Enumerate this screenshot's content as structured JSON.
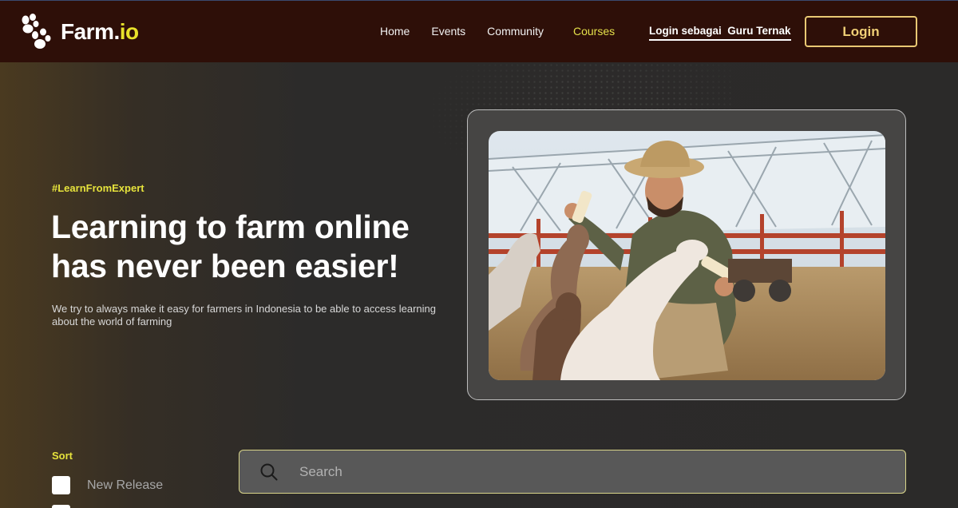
{
  "brand": {
    "name_main": "Farm.",
    "name_accent": "io",
    "accent_color": "#e8e22a"
  },
  "nav": {
    "items": [
      {
        "label": "Home"
      },
      {
        "label": "Events"
      },
      {
        "label": "Community"
      },
      {
        "label": "Courses",
        "active": true
      }
    ],
    "guru_link": "Login sebagai  Guru Ternak",
    "login_button": "Login"
  },
  "hero": {
    "hashtag": "#LearnFromExpert",
    "headline": "Learning to farm online has never been easier!",
    "subtext": "We try to always make it easy for farmers in Indonesia to be able to access learning about the world of farming",
    "image_icon": "farmer-feeding-goats-photo"
  },
  "sort": {
    "label": "Sort",
    "options": [
      {
        "label": "New Release",
        "checked": false
      }
    ]
  },
  "search": {
    "placeholder": "Search",
    "value": ""
  },
  "colors": {
    "topbar": "#2e0f08",
    "background": "#2b2a29",
    "accent_yellow": "#e6e33c",
    "login_border": "#e9c873"
  }
}
